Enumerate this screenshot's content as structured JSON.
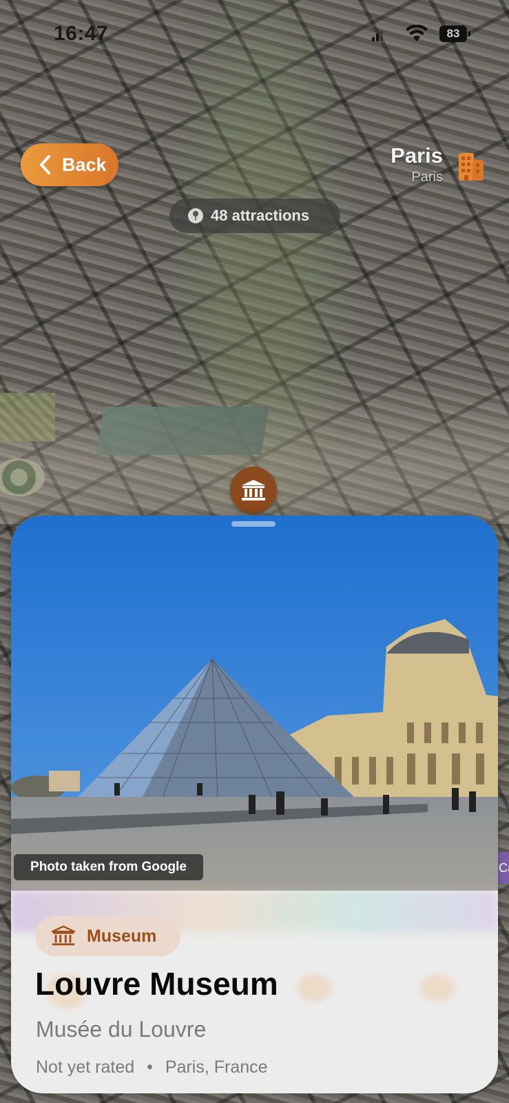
{
  "status_bar": {
    "time": "16:47",
    "battery": "83"
  },
  "nav": {
    "back_label": "Back"
  },
  "city": {
    "name": "Paris",
    "subtitle": "Paris"
  },
  "attractions": {
    "label": "48 attractions"
  },
  "sheet": {
    "photo_caption": "Photo taken from Google",
    "category": "Museum",
    "title": "Louvre Museum",
    "subtitle": "Musée du Louvre",
    "rating": "Not yet rated",
    "separator": "•",
    "location": "Paris, France"
  },
  "side_tag": "Ca",
  "colors": {
    "accent_orange": "#e38a34",
    "marker_brown": "#8a4a1d",
    "category_bg": "#ead9cc",
    "category_text": "#9a4f1c"
  },
  "icons": {
    "back": "chevron-left-icon",
    "city": "building-icon",
    "attractions": "location-pin-icon",
    "marker": "museum-icon",
    "category": "museum-icon"
  }
}
